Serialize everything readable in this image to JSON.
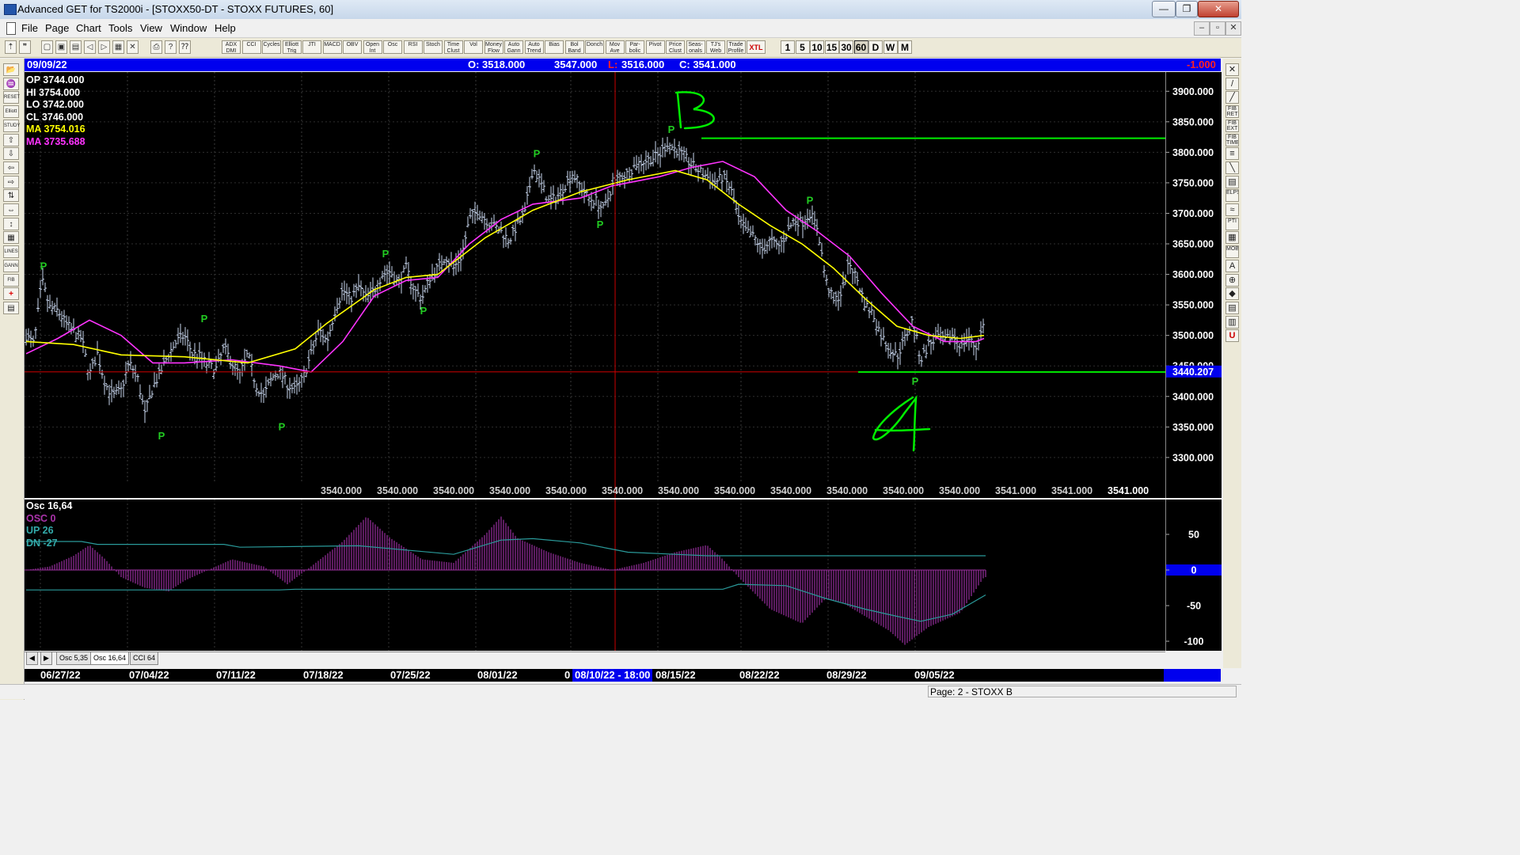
{
  "window": {
    "title": "Advanced GET for TS2000i - [STOXX50-DT - STOXX FUTURES, 60]",
    "minimize": "—",
    "maximize": "❐",
    "close": "✕"
  },
  "menu": {
    "items": [
      "File",
      "Page",
      "Chart",
      "Tools",
      "View",
      "Window",
      "Help"
    ],
    "mdi_min": "–",
    "mdi_restore": "▫",
    "mdi_close": "✕"
  },
  "toolbar": {
    "indicator_buttons": [
      "ADX DMI",
      "CCI",
      "Cycles",
      "Elliott Trig",
      "JTI",
      "MACD",
      "OBV",
      "Open Int",
      "Osc",
      "RSI",
      "Stoch",
      "Time Clust",
      "Vol",
      "Money Flow",
      "Auto Gann",
      "Auto Trend",
      "Bias",
      "Bol Band",
      "Donch",
      "Mov Ave",
      "Par- bolic",
      "Pivot",
      "Price Clust",
      "Seas- onals",
      "TJ's Web",
      "Trade Profile",
      "XTL"
    ],
    "period_buttons": [
      "1",
      "5",
      "10",
      "15",
      "30",
      "60",
      "D",
      "W",
      "M"
    ],
    "active_period": "60"
  },
  "left_tools": [
    "📂",
    "♒",
    "RESET",
    "Elliott",
    "STUDY",
    "⇧",
    "⇩",
    "⇦",
    "⇨",
    "⇅",
    "⇔",
    "↕",
    "▦",
    "LINES",
    "GANN",
    "FIB",
    "+",
    "▤"
  ],
  "right_tools": [
    "✕",
    "/",
    "╱",
    "FIB RET",
    "FIB EXT",
    "FIB TIME",
    "≡",
    "╲",
    "▤",
    "ELPS",
    "≈",
    "PTI",
    "▦",
    "MOB",
    "A",
    "⊕",
    "◆",
    "▤",
    "▥",
    "U"
  ],
  "header": {
    "date": "09/09/22",
    "open": "O: 3518.000",
    "high": "3547.000",
    "low_label": "L:",
    "low": "3516.000",
    "close": "C: 3541.000",
    "change": "-1.000"
  },
  "readouts": [
    {
      "text": "OP  3744.000",
      "color": "#ffffff"
    },
    {
      "text": "HI   3754.000",
      "color": "#ffffff"
    },
    {
      "text": "LO  3742.000",
      "color": "#ffffff"
    },
    {
      "text": "CL   3746.000",
      "color": "#ffffff"
    },
    {
      "text": "MA  3754.016",
      "color": "#ffff00"
    },
    {
      "text": "MA  3735.688",
      "color": "#ff33ff"
    }
  ],
  "osc_readouts": [
    {
      "text": "Osc 16,64",
      "color": "#ffffff"
    },
    {
      "text": "OSC 0",
      "color": "#aa33aa"
    },
    {
      "text": "UP  26",
      "color": "#33aaaa"
    },
    {
      "text": "DN  -27",
      "color": "#33aaaa"
    }
  ],
  "price_axis": {
    "ticks": [
      "3900.000",
      "3850.000",
      "3800.000",
      "3750.000",
      "3700.000",
      "3650.000",
      "3600.000",
      "3550.000",
      "3500.000",
      "3450.000",
      "3400.000",
      "3350.000",
      "3300.000"
    ],
    "cursor_label": "3440.207"
  },
  "bottom_values": [
    "3540.000",
    "3540.000",
    "3540.000",
    "3540.000",
    "3540.000",
    "3540.000",
    "3540.000",
    "3540.000",
    "3540.000",
    "3540.000",
    "3540.000",
    "3540.000",
    "3541.000",
    "3541.000",
    "3541.000"
  ],
  "osc_axis": {
    "ticks": [
      "50",
      "0",
      "-50",
      "-100"
    ]
  },
  "annotations": {
    "pivot_label": "P",
    "b_label": "B",
    "a_label": "A"
  },
  "tabs": {
    "nav_left": "◀",
    "nav_right": "▶",
    "items": [
      "Osc 5,35",
      "Osc 16,64",
      "CCI 64"
    ],
    "active": "Osc 16,64"
  },
  "time_axis": {
    "labels": [
      "06/27/22",
      "07/04/22",
      "07/11/22",
      "07/18/22",
      "07/25/22",
      "08/01/22",
      "08/15/22",
      "08/22/22",
      "08/29/22",
      "09/05/22"
    ],
    "cursor_label": "08/10/22 - 18:00"
  },
  "status": {
    "page": "Page: 2 - STOXX B"
  },
  "chart_data": {
    "type": "candlestick",
    "title": "STOXX50-DT - STOXX FUTURES, 60",
    "ylim": [
      3270,
      3925
    ],
    "price_anchors": [
      [
        0,
        3500
      ],
      [
        10,
        3485
      ],
      [
        20,
        3590
      ],
      [
        30,
        3545
      ],
      [
        40,
        3540
      ],
      [
        50,
        3520
      ],
      [
        60,
        3505
      ],
      [
        70,
        3495
      ],
      [
        80,
        3435
      ],
      [
        90,
        3470
      ],
      [
        100,
        3420
      ],
      [
        110,
        3400
      ],
      [
        120,
        3410
      ],
      [
        130,
        3455
      ],
      [
        140,
        3435
      ],
      [
        150,
        3370
      ],
      [
        160,
        3415
      ],
      [
        170,
        3440
      ],
      [
        180,
        3470
      ],
      [
        190,
        3490
      ],
      [
        200,
        3500
      ],
      [
        210,
        3470
      ],
      [
        220,
        3465
      ],
      [
        230,
        3450
      ],
      [
        240,
        3445
      ],
      [
        250,
        3480
      ],
      [
        260,
        3455
      ],
      [
        270,
        3435
      ],
      [
        280,
        3470
      ],
      [
        290,
        3420
      ],
      [
        300,
        3400
      ],
      [
        310,
        3430
      ],
      [
        320,
        3440
      ],
      [
        330,
        3420
      ],
      [
        340,
        3410
      ],
      [
        350,
        3430
      ],
      [
        360,
        3470
      ],
      [
        370,
        3510
      ],
      [
        380,
        3490
      ],
      [
        390,
        3540
      ],
      [
        400,
        3575
      ],
      [
        410,
        3560
      ],
      [
        420,
        3580
      ],
      [
        430,
        3560
      ],
      [
        440,
        3575
      ],
      [
        450,
        3600
      ],
      [
        460,
        3605
      ],
      [
        470,
        3585
      ],
      [
        480,
        3610
      ],
      [
        490,
        3575
      ],
      [
        500,
        3560
      ],
      [
        510,
        3595
      ],
      [
        520,
        3610
      ],
      [
        530,
        3630
      ],
      [
        540,
        3610
      ],
      [
        550,
        3630
      ],
      [
        560,
        3690
      ],
      [
        570,
        3705
      ],
      [
        580,
        3690
      ],
      [
        590,
        3680
      ],
      [
        600,
        3670
      ],
      [
        610,
        3655
      ],
      [
        620,
        3680
      ],
      [
        630,
        3700
      ],
      [
        640,
        3775
      ],
      [
        650,
        3750
      ],
      [
        660,
        3720
      ],
      [
        670,
        3725
      ],
      [
        680,
        3745
      ],
      [
        690,
        3765
      ],
      [
        700,
        3745
      ],
      [
        710,
        3725
      ],
      [
        720,
        3720
      ],
      [
        730,
        3705
      ],
      [
        740,
        3745
      ],
      [
        750,
        3760
      ],
      [
        760,
        3765
      ],
      [
        770,
        3780
      ],
      [
        780,
        3785
      ],
      [
        790,
        3790
      ],
      [
        800,
        3795
      ],
      [
        810,
        3815
      ],
      [
        820,
        3805
      ],
      [
        830,
        3795
      ],
      [
        840,
        3780
      ],
      [
        850,
        3770
      ],
      [
        860,
        3760
      ],
      [
        870,
        3750
      ],
      [
        880,
        3760
      ],
      [
        890,
        3740
      ],
      [
        900,
        3690
      ],
      [
        910,
        3670
      ],
      [
        920,
        3660
      ],
      [
        930,
        3640
      ],
      [
        940,
        3655
      ],
      [
        950,
        3645
      ],
      [
        960,
        3665
      ],
      [
        970,
        3690
      ],
      [
        980,
        3685
      ],
      [
        990,
        3700
      ],
      [
        1000,
        3675
      ],
      [
        1010,
        3590
      ],
      [
        1020,
        3555
      ],
      [
        1030,
        3570
      ],
      [
        1040,
        3620
      ],
      [
        1050,
        3590
      ],
      [
        1060,
        3550
      ],
      [
        1070,
        3535
      ],
      [
        1080,
        3500
      ],
      [
        1090,
        3480
      ],
      [
        1100,
        3465
      ],
      [
        1110,
        3495
      ],
      [
        1120,
        3525
      ],
      [
        1130,
        3460
      ],
      [
        1140,
        3485
      ],
      [
        1150,
        3495
      ],
      [
        1160,
        3490
      ],
      [
        1170,
        3500
      ],
      [
        1180,
        3485
      ],
      [
        1190,
        3495
      ],
      [
        1200,
        3480
      ],
      [
        1210,
        3520
      ]
    ],
    "ma_yellow": [
      [
        0,
        3490
      ],
      [
        60,
        3485
      ],
      [
        120,
        3468
      ],
      [
        200,
        3465
      ],
      [
        280,
        3455
      ],
      [
        340,
        3478
      ],
      [
        380,
        3520
      ],
      [
        440,
        3575
      ],
      [
        480,
        3595
      ],
      [
        520,
        3600
      ],
      [
        580,
        3660
      ],
      [
        640,
        3705
      ],
      [
        700,
        3735
      ],
      [
        760,
        3755
      ],
      [
        820,
        3770
      ],
      [
        860,
        3755
      ],
      [
        900,
        3715
      ],
      [
        940,
        3680
      ],
      [
        980,
        3650
      ],
      [
        1020,
        3610
      ],
      [
        1060,
        3560
      ],
      [
        1100,
        3515
      ],
      [
        1140,
        3500
      ],
      [
        1180,
        3495
      ],
      [
        1210,
        3500
      ]
    ],
    "ma_magenta": [
      [
        0,
        3470
      ],
      [
        40,
        3495
      ],
      [
        80,
        3525
      ],
      [
        120,
        3500
      ],
      [
        160,
        3455
      ],
      [
        200,
        3455
      ],
      [
        260,
        3460
      ],
      [
        320,
        3450
      ],
      [
        360,
        3440
      ],
      [
        400,
        3490
      ],
      [
        440,
        3565
      ],
      [
        480,
        3590
      ],
      [
        520,
        3595
      ],
      [
        560,
        3650
      ],
      [
        600,
        3690
      ],
      [
        640,
        3715
      ],
      [
        700,
        3725
      ],
      [
        740,
        3745
      ],
      [
        800,
        3760
      ],
      [
        840,
        3775
      ],
      [
        880,
        3785
      ],
      [
        920,
        3760
      ],
      [
        960,
        3705
      ],
      [
        1000,
        3670
      ],
      [
        1040,
        3630
      ],
      [
        1080,
        3570
      ],
      [
        1120,
        3515
      ],
      [
        1160,
        3490
      ],
      [
        1200,
        3490
      ],
      [
        1210,
        3495
      ]
    ],
    "osc_anchors": [
      [
        0,
        0
      ],
      [
        30,
        5
      ],
      [
        60,
        20
      ],
      [
        80,
        35
      ],
      [
        100,
        15
      ],
      [
        120,
        -10
      ],
      [
        150,
        -25
      ],
      [
        180,
        -30
      ],
      [
        200,
        -15
      ],
      [
        220,
        -5
      ],
      [
        260,
        15
      ],
      [
        300,
        5
      ],
      [
        330,
        -20
      ],
      [
        360,
        5
      ],
      [
        400,
        40
      ],
      [
        430,
        75
      ],
      [
        460,
        45
      ],
      [
        500,
        15
      ],
      [
        540,
        10
      ],
      [
        580,
        50
      ],
      [
        600,
        75
      ],
      [
        620,
        45
      ],
      [
        660,
        25
      ],
      [
        700,
        10
      ],
      [
        740,
        0
      ],
      [
        780,
        10
      ],
      [
        820,
        25
      ],
      [
        860,
        35
      ],
      [
        880,
        15
      ],
      [
        900,
        -10
      ],
      [
        940,
        -55
      ],
      [
        980,
        -75
      ],
      [
        1010,
        -40
      ],
      [
        1030,
        -45
      ],
      [
        1060,
        -65
      ],
      [
        1090,
        -85
      ],
      [
        1110,
        -105
      ],
      [
        1140,
        -80
      ],
      [
        1180,
        -60
      ],
      [
        1210,
        -10
      ]
    ],
    "pivots": [
      {
        "x": 22,
        "price": 3600,
        "type": "high"
      },
      {
        "x": 171,
        "price": 3348,
        "type": "low"
      },
      {
        "x": 225,
        "price": 3514,
        "type": "high"
      },
      {
        "x": 323,
        "price": 3363,
        "type": "low"
      },
      {
        "x": 454,
        "price": 3620,
        "type": "high"
      },
      {
        "x": 502,
        "price": 3553,
        "type": "low"
      },
      {
        "x": 645,
        "price": 3784,
        "type": "high"
      },
      {
        "x": 725,
        "price": 3694,
        "type": "low"
      },
      {
        "x": 815,
        "price": 3824,
        "type": "high"
      },
      {
        "x": 990,
        "price": 3708,
        "type": "high"
      },
      {
        "x": 1123,
        "price": 3437,
        "type": "low"
      }
    ],
    "levels": [
      {
        "name": "B",
        "price": 3823,
        "color": "#00ee00"
      },
      {
        "name": "A",
        "price": 3440,
        "color": "#00ee00"
      }
    ],
    "cursor": {
      "time": "08/10/22 - 18:00",
      "price": 3440.207
    }
  }
}
